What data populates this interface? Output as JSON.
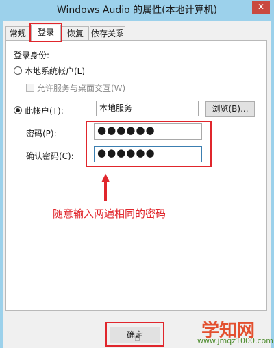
{
  "window": {
    "title": "Windows Audio 的属性(本地计算机)",
    "close_glyph": "✕"
  },
  "tabs": [
    {
      "label": "常规"
    },
    {
      "label": "登录"
    },
    {
      "label": "恢复"
    },
    {
      "label": "依存关系"
    }
  ],
  "logon": {
    "section_label": "登录身份:",
    "local_system": {
      "label": "本地系统帐户(L)",
      "selected": false
    },
    "allow_desktop": {
      "label": "允许服务与桌面交互(W)",
      "checked": false,
      "enabled": false
    },
    "this_account": {
      "label": "此帐户(T):",
      "selected": true,
      "value": "本地服务"
    },
    "browse_button": "浏览(B)...",
    "password": {
      "label": "密码(P):",
      "value": "●●●●●●"
    },
    "confirm_password": {
      "label": "确认密码(C):",
      "value": "●●●●●●"
    }
  },
  "annotation": {
    "text": "随意输入两遍相同的密码",
    "arrow_glyph": "▲",
    "color": "#e0262c"
  },
  "footer": {
    "ok_button": "确定"
  },
  "watermark": {
    "brand": "学知网",
    "url": "www.jmqz1000.com"
  },
  "colors": {
    "titlebar": "#9cd1eb",
    "highlight": "#e0262c",
    "focus_border": "#3c7fb1"
  }
}
